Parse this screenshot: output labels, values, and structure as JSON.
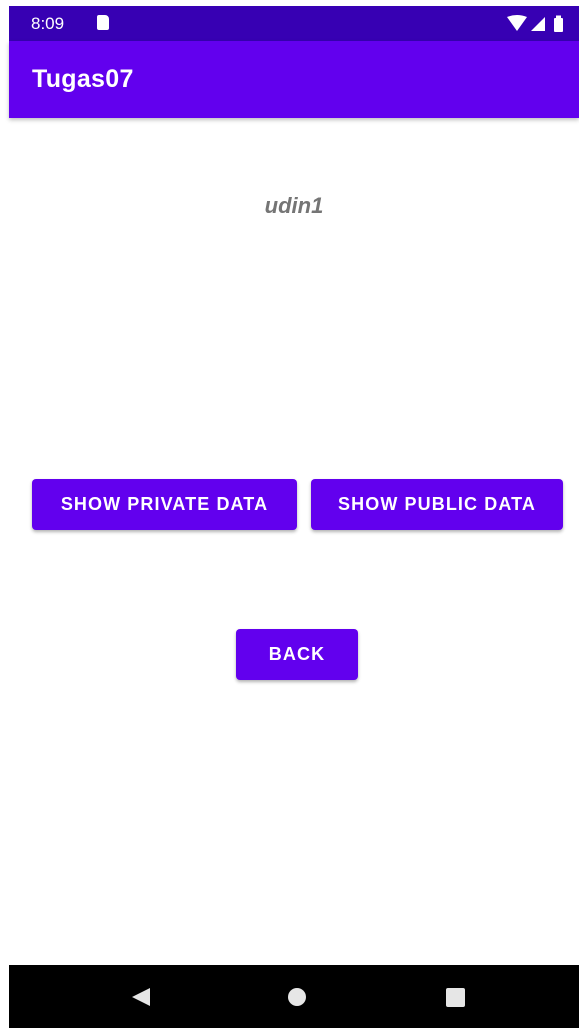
{
  "status_bar": {
    "time": "8:09",
    "icons": [
      "sd-card-icon",
      "wifi-icon",
      "signal-icon",
      "battery-icon"
    ]
  },
  "app_bar": {
    "title": "Tugas07"
  },
  "main": {
    "username": "udin1",
    "show_private_label": "SHOW PRIVATE DATA",
    "show_public_label": "SHOW PUBLIC DATA",
    "back_label": "BACK"
  },
  "nav_bar": {
    "icons": [
      "back-icon",
      "home-icon",
      "recents-icon"
    ]
  },
  "colors": {
    "primary": "#6200ee",
    "primary_dark": "#3700b3",
    "username_text": "#757575",
    "nav_background": "#000000"
  }
}
